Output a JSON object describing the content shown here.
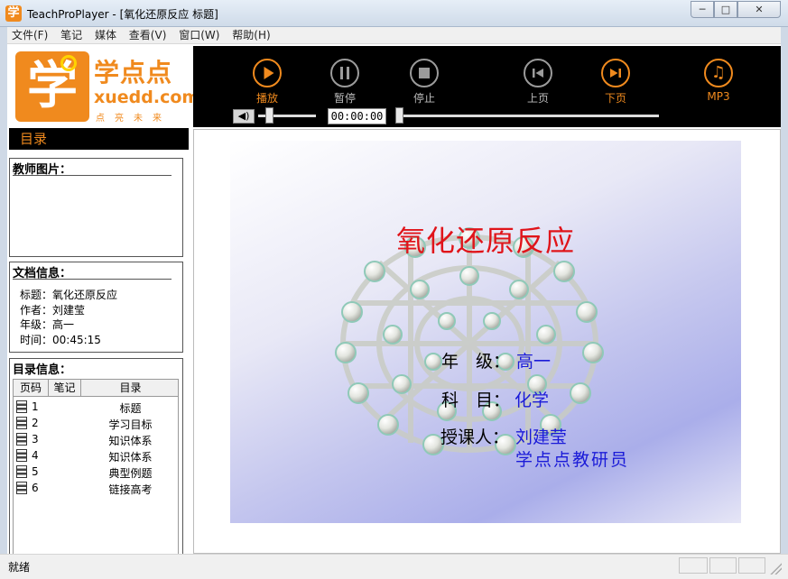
{
  "window": {
    "title": "TeachProPlayer - [氧化还原反应 标题]",
    "icon_glyph": "学",
    "min_glyph": "─",
    "max_glyph": "□",
    "close_glyph": "✕"
  },
  "menu": [
    "文件(F)",
    "笔记",
    "媒体",
    "查看(V)",
    "窗口(W)",
    "帮助(H)"
  ],
  "logo": {
    "badge": "学",
    "cn": "学点点",
    "en": "xuedd.com",
    "sub": "点亮未来"
  },
  "toolbar": {
    "buttons": [
      {
        "label": "播放",
        "icon": "play-icon",
        "active": true
      },
      {
        "label": "暂停",
        "icon": "pause-icon",
        "active": false
      },
      {
        "label": "停止",
        "icon": "stop-icon",
        "active": false
      },
      {
        "label": "上页",
        "icon": "prev-page-icon",
        "active": false
      },
      {
        "label": "下页",
        "icon": "next-page-icon",
        "active": true
      },
      {
        "label": "MP3",
        "icon": "music-note-icon",
        "active": true
      }
    ],
    "time": "00:00:00",
    "volume_glyph": "◀)"
  },
  "sidebar": {
    "toc_header": "目录",
    "teacher_panel_title": "教师图片：",
    "doc_panel_title": "文档信息：",
    "doc_info": [
      "标题：氧化还原反应",
      "作者：刘建莹",
      "年级：高一",
      "时间：00:45:15"
    ],
    "outline_panel_title": "目录信息：",
    "outline_headers": {
      "page": "页码",
      "note": "笔记",
      "toc": "目录"
    },
    "outline_rows": [
      {
        "page": "1",
        "label": "标题"
      },
      {
        "page": "2",
        "label": "学习目标"
      },
      {
        "page": "3",
        "label": "知识体系"
      },
      {
        "page": "4",
        "label": "知识体系"
      },
      {
        "page": "5",
        "label": "典型例题"
      },
      {
        "page": "6",
        "label": "链接高考"
      }
    ]
  },
  "slide": {
    "title": "氧化还原反应",
    "grade_label": "年　级：",
    "grade_value": "高一",
    "subject_label": "科　目：",
    "subject_value": "化学",
    "teacher_label": "授课人：",
    "teacher_value": "刘建莹",
    "team_value": "学点点教研员"
  },
  "status": {
    "text": "就绪"
  },
  "colors": {
    "accent": "#f08a1e",
    "toolbar_bg": "#000000",
    "slide_title": "#e0141a",
    "slide_value": "#1a1ad8"
  }
}
